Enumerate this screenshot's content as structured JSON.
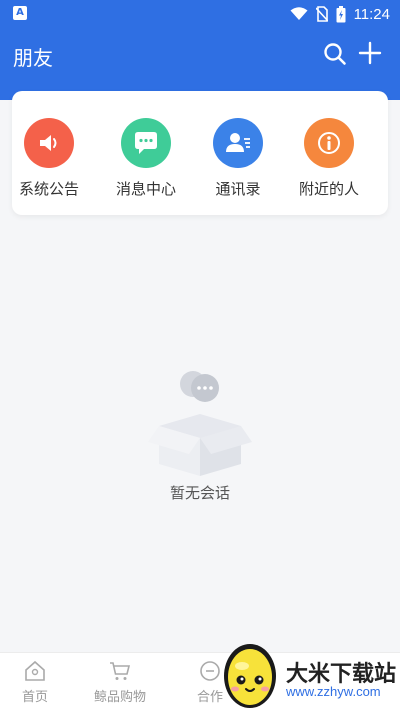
{
  "status_bar": {
    "time": "11:24",
    "app_icon": "A"
  },
  "header": {
    "title": "朋友"
  },
  "quick_actions": [
    {
      "label": "系统公告",
      "icon": "speaker-icon",
      "color": "#f4614a"
    },
    {
      "label": "消息中心",
      "icon": "message-icon",
      "color": "#3fcc98"
    },
    {
      "label": "通讯录",
      "icon": "contacts-icon",
      "color": "#3b82e8"
    },
    {
      "label": "附近的人",
      "icon": "info-icon",
      "color": "#f5873d"
    }
  ],
  "empty_state": {
    "text": "暂无会话"
  },
  "tab_bar": {
    "items": [
      {
        "label": "首页",
        "icon": "home-icon"
      },
      {
        "label": "鲸品购物",
        "icon": "cart-icon"
      },
      {
        "label": "合作",
        "icon": "cooperate-icon"
      }
    ]
  },
  "watermark": {
    "title": "大米下载站",
    "url": "www.zzhyw.com"
  },
  "colors": {
    "primary": "#2f6fe3"
  }
}
